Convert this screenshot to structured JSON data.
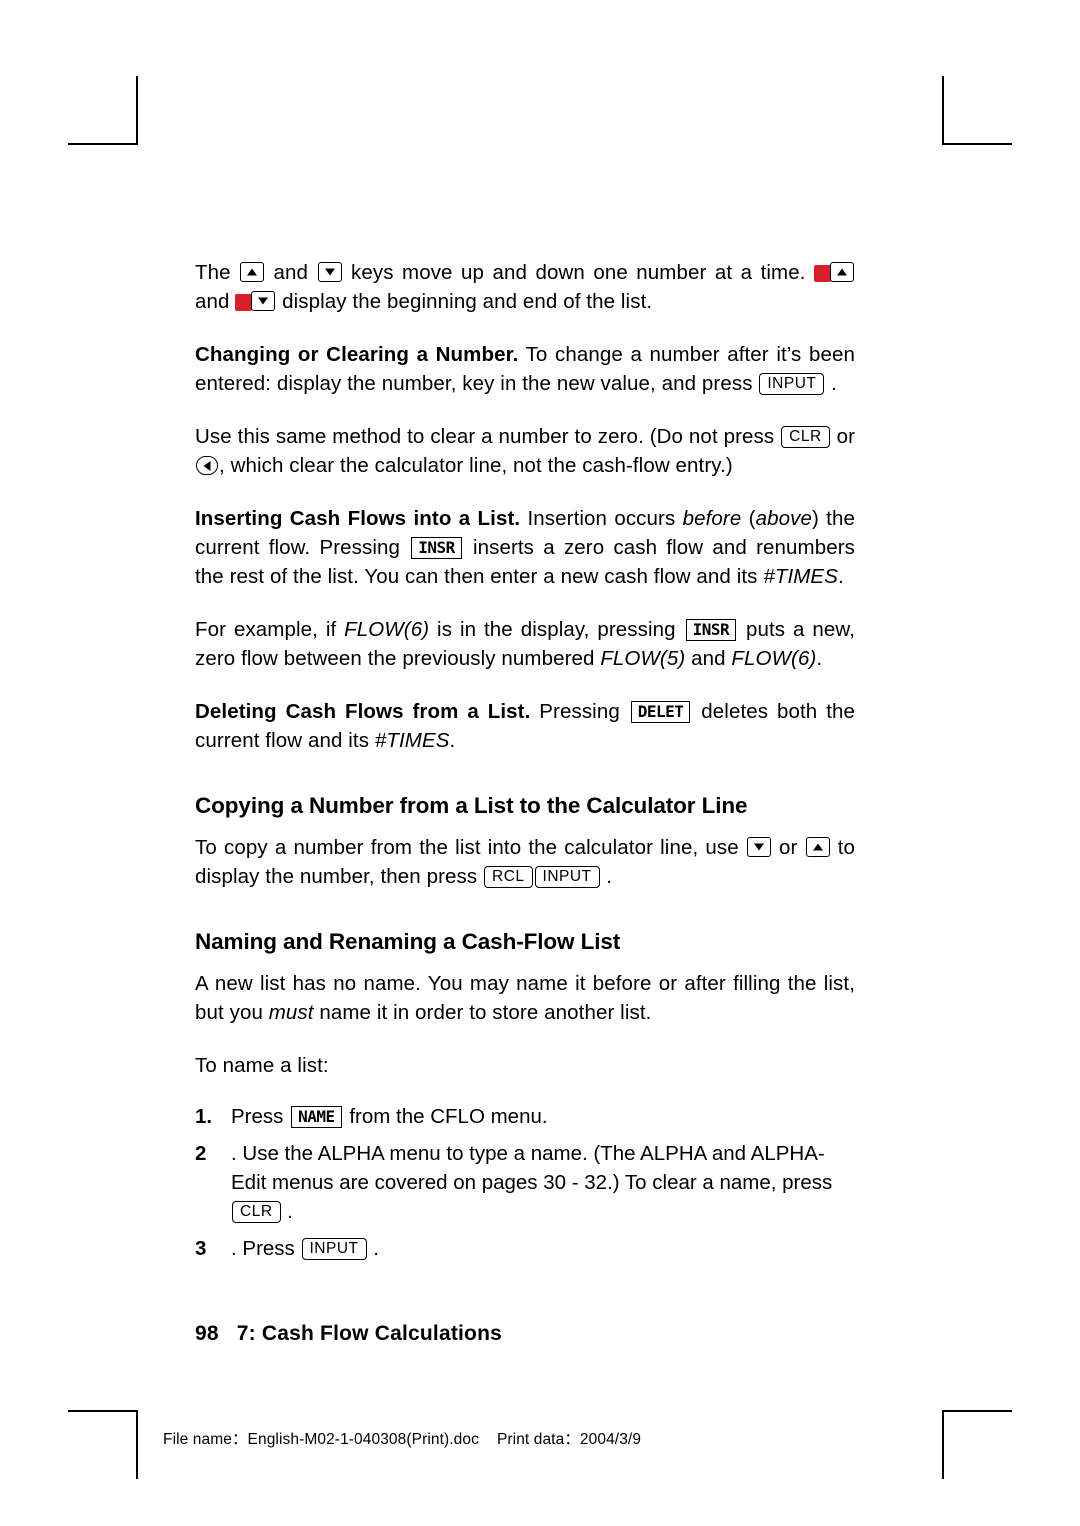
{
  "document": {
    "paragraphs": {
      "p1_pre": "The ",
      "p1_mid": " and ",
      "p1_post": " keys move up and down one number at a time.",
      "p1b_and": " and ",
      "p1b_post": " display the beginning and end of the list.",
      "p2_run": "Changing or Clearing a Number.",
      "p2_a": " To change a number after it’s been entered: display the number, key in the new value, and press ",
      "p2_b": " .",
      "p3_a": "Use this same method to clear a number to zero. (Do not press ",
      "p3_b": " or ",
      "p3_c": ", which clear the calculator line, not the cash-flow entry.)",
      "p4_run": "Inserting Cash Flows into a List.",
      "p4_a": " Insertion occurs ",
      "p4_ital1": "before",
      "p4_b": " (",
      "p4_ital2": "above",
      "p4_c": ") the current flow. Pressing ",
      "p4_d": " inserts a zero cash flow and renumbers the rest of the list. You can then enter a new cash flow and its ",
      "p4_ital3": "#TIMES",
      "p4_e": ".",
      "p5_a": "For example, if ",
      "p5_ital1": "FLOW(6)",
      "p5_b": " is in the display, pressing ",
      "p5_c": " puts a new, zero flow between the previously numbered ",
      "p5_ital2": "FLOW(5)",
      "p5_d": " and ",
      "p5_ital3": "FLOW(6)",
      "p5_e": ".",
      "p6_run": "Deleting Cash Flows from a List.",
      "p6_a": " Pressing ",
      "p6_b": " deletes both the current flow and its ",
      "p6_ital": "#TIMES",
      "p6_c": ".",
      "h1": "Copying a Number from a List to the Calculator Line",
      "p7_a": "To copy a number from the list into the calculator line, use ",
      "p7_b": " or ",
      "p7_c": " to display the number, then press ",
      "p7_d": " .",
      "h2": "Naming and Renaming a Cash-Flow List",
      "p8_a": "A new list has no name. You may name it before or after filling the list, but you ",
      "p8_ital": "must",
      "p8_b": " name it in order to store another list.",
      "p9": "To name a list:",
      "step1_num": "1.",
      "step1_a": "Press ",
      "step1_b": " from the CFLO menu.",
      "step2_num": "2",
      "step2_a": ". Use the ALPHA menu to type a name. (The ALPHA and ALPHA-Edit menus are covered on pages 30 - 32.) To clear a name, press ",
      "step2_b": " .",
      "step3_num": "3",
      "step3_a": ". Press ",
      "step3_b": " ."
    },
    "keys": {
      "input": "INPUT",
      "clr": "CLR",
      "insr": "INSR",
      "delet": "DELET",
      "rcl": "RCL",
      "name": "NAME"
    },
    "footer": {
      "page_number": "98",
      "chapter": "7: Cash Flow Calculations"
    },
    "print_info": {
      "file_label": "File name：English-M02-1-040308(Print).doc",
      "print_label": "Print data：2004/3/9"
    }
  }
}
